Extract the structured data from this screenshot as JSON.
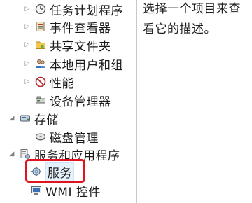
{
  "tree": {
    "items": [
      {
        "label": "任务计划程序",
        "icon": "clock-icon",
        "expander": "▷"
      },
      {
        "label": "事件查看器",
        "icon": "event-viewer-icon",
        "expander": "▷"
      },
      {
        "label": "共享文件夹",
        "icon": "shared-folder-icon",
        "expander": "▷"
      },
      {
        "label": "本地用户和组",
        "icon": "users-icon",
        "expander": "▷"
      },
      {
        "label": "性能",
        "icon": "performance-icon",
        "expander": "▷"
      },
      {
        "label": "设备管理器",
        "icon": "device-manager-icon",
        "expander": ""
      },
      {
        "label": "存储",
        "icon": "storage-icon",
        "expander": "◢"
      },
      {
        "label": "磁盘管理",
        "icon": "disk-icon",
        "expander": ""
      },
      {
        "label": "服务和应用程序",
        "icon": "services-apps-icon",
        "expander": "◢"
      },
      {
        "label": "服务",
        "icon": "services-gear-icon",
        "expander": ""
      },
      {
        "label": "WMI 控件",
        "icon": "wmi-icon",
        "expander": ""
      }
    ]
  },
  "detail": {
    "text": "选择一个项目来查看它的描述。"
  },
  "colors": {
    "highlight_box": "#e0141e",
    "selection_bg": "#e5f1fb"
  }
}
